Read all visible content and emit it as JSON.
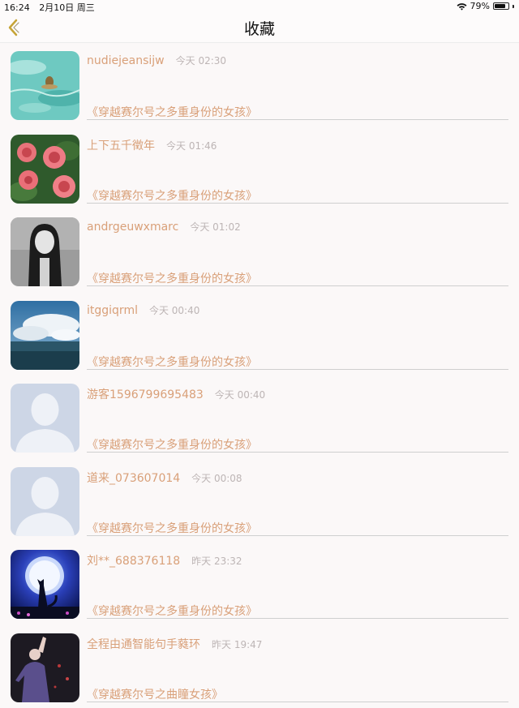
{
  "status": {
    "time": "16:24",
    "date": "2月10日 周三",
    "battery": "79%",
    "battery_level": 0.79
  },
  "nav": {
    "title": "收藏",
    "back_icon": "chevron-left-icon"
  },
  "colors": {
    "accent": "#d9a079",
    "timestamp": "#bdb5b5",
    "background": "#fbf8f8"
  },
  "items": [
    {
      "username": "nudiejeansijw",
      "time": "今天 02:30",
      "book": "《穿越赛尔号之多重身份的女孩》",
      "avatar": "water-photo"
    },
    {
      "username": "上下五千徵年",
      "time": "今天 01:46",
      "book": "《穿越赛尔号之多重身份的女孩》",
      "avatar": "roses-photo"
    },
    {
      "username": "andrgeuwxmarc",
      "time": "今天 01:02",
      "book": "《穿越赛尔号之多重身份的女孩》",
      "avatar": "girl-photo"
    },
    {
      "username": "itggiqrml",
      "time": "今天 00:40",
      "book": "《穿越赛尔号之多重身份的女孩》",
      "avatar": "sea-sky-photo"
    },
    {
      "username": "游客1596799695483",
      "time": "今天 00:40",
      "book": "《穿越赛尔号之多重身份的女孩》",
      "avatar": "default-person-icon"
    },
    {
      "username": "道来_073607014",
      "time": "今天 00:08",
      "book": "《穿越赛尔号之多重身份的女孩》",
      "avatar": "default-person-icon"
    },
    {
      "username": "刘**_688376118",
      "time": "昨天 23:32",
      "book": "《穿越赛尔号之多重身份的女孩》",
      "avatar": "cat-moon-photo"
    },
    {
      "username": "全程由通智能句手蕤环",
      "time": "昨天 19:47",
      "book": "《穿越赛尔号之曲瞳女孩》",
      "avatar": "dancer-photo"
    }
  ]
}
